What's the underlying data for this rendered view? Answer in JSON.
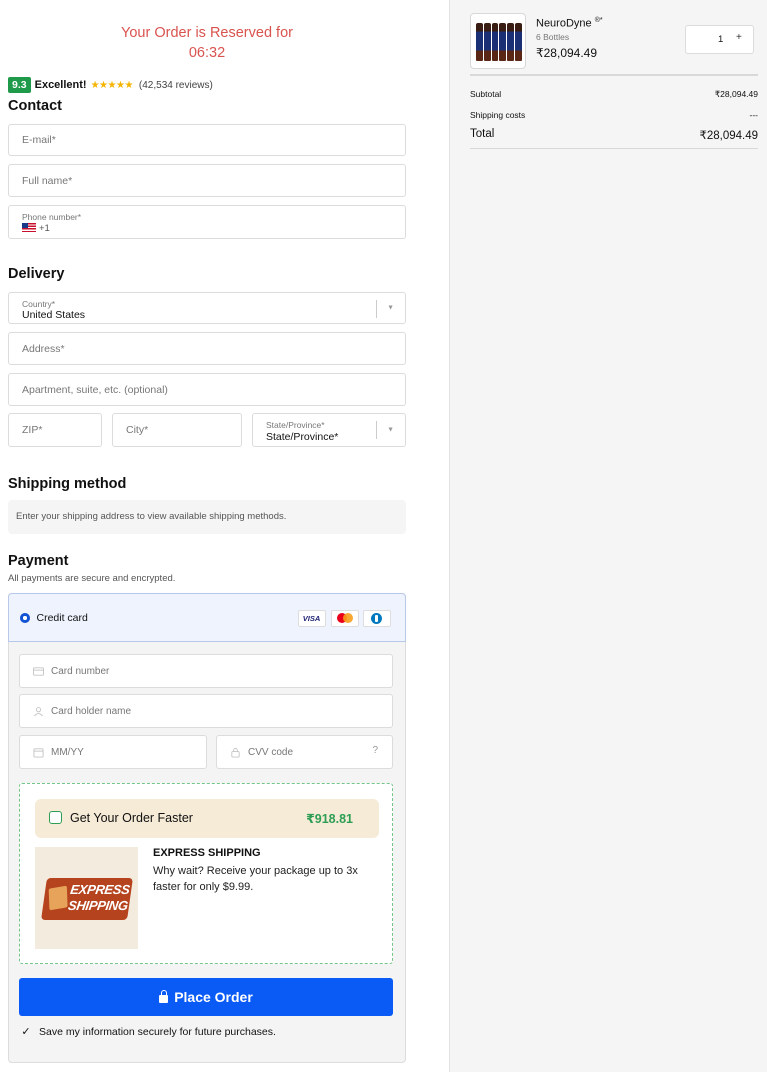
{
  "timer": {
    "title": "Your Order is Reserved for",
    "value": "06:32"
  },
  "rating": {
    "score": "9.3",
    "label": "Excellent!",
    "stars": "★★★★★",
    "reviews": "(42,534 reviews)"
  },
  "contact": {
    "title": "Contact",
    "email_placeholder": "E-mail*",
    "fullname_placeholder": "Full name*",
    "phone_label": "Phone number*",
    "phone_prefix": "+1"
  },
  "delivery": {
    "title": "Delivery",
    "country_label": "Country*",
    "country_value": "United States",
    "address_placeholder": "Address*",
    "apartment_placeholder": "Apartment, suite, etc. (optional)",
    "zip_placeholder": "ZIP*",
    "city_placeholder": "City*",
    "state_label": "State/Province*",
    "state_value": "State/Province*"
  },
  "shipping": {
    "title": "Shipping method",
    "message": "Enter your shipping address to view available shipping methods."
  },
  "payment": {
    "title": "Payment",
    "subtitle": "All payments are secure and encrypted.",
    "method_label": "Credit card",
    "card_brands": [
      "VISA",
      "mastercard",
      "diners"
    ],
    "card_number_placeholder": "Card number",
    "card_holder_placeholder": "Card holder name",
    "expiry_placeholder": "MM/YY",
    "cvv_placeholder": "CVV code",
    "cvv_tail": "?"
  },
  "upsell": {
    "label": "Get Your Order Faster",
    "price": "₹918.81",
    "image_text_1": "EXPRESS",
    "image_text_2": "SHIPPING",
    "title": "EXPRESS SHIPPING",
    "description": "Why wait? Receive your package up to 3x faster for only $9.99."
  },
  "place_order": {
    "label": "Place Order"
  },
  "save_info": {
    "checked": true,
    "label": "Save my information securely for future purchases."
  },
  "cart": {
    "product_name": "NeuroDyne",
    "product_mark": "®*",
    "variant": "6 Bottles",
    "price": "₹28,094.49",
    "quantity": "1",
    "plus": "+",
    "subtotal_label": "Subtotal",
    "subtotal_value": "₹28,094.49",
    "shipping_label": "Shipping costs",
    "shipping_value": "---",
    "total_label": "Total",
    "total_value": "₹28,094.49"
  },
  "colors": {
    "accent_blue": "#0a5af5",
    "timer_red": "#d9534f",
    "success_green": "#2e9e55",
    "rating_green": "#1f9a4b"
  }
}
